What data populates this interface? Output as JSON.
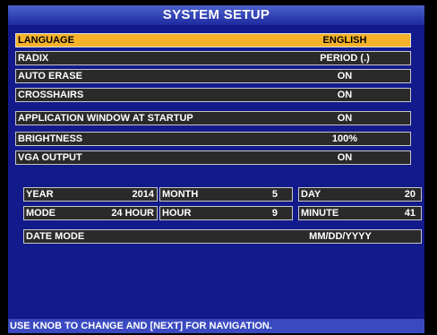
{
  "title": "SYSTEM SETUP",
  "settings": [
    {
      "label": "LANGUAGE",
      "value": "ENGLISH"
    },
    {
      "label": "RADIX",
      "value": "PERIOD (.)"
    },
    {
      "label": "AUTO ERASE",
      "value": "ON"
    },
    {
      "label": "CROSSHAIRS",
      "value": "ON"
    },
    {
      "label": "APPLICATION WINDOW AT STARTUP",
      "value": "ON"
    },
    {
      "label": "BRIGHTNESS",
      "value": "100%"
    },
    {
      "label": "VGA OUTPUT",
      "value": "ON"
    }
  ],
  "datetime": {
    "year": {
      "label": "YEAR",
      "value": "2014"
    },
    "month": {
      "label": "MONTH",
      "value": "5"
    },
    "day": {
      "label": "DAY",
      "value": "20"
    },
    "mode": {
      "label": "MODE",
      "value": "24 HOUR"
    },
    "hour": {
      "label": "HOUR",
      "value": "9"
    },
    "minute": {
      "label": "MINUTE",
      "value": "41"
    }
  },
  "date_mode": {
    "label": "DATE MODE",
    "value": "MM/DD/YYYY"
  },
  "status": "USE KNOB TO CHANGE AND [NEXT] FOR NAVIGATION.",
  "colors": {
    "background": "#131a8c",
    "title_bar": "#2a3ab3",
    "selected_row": "#f6b32a",
    "row_bg": "#2a2a2a",
    "status_bar": "#3a49c0"
  }
}
